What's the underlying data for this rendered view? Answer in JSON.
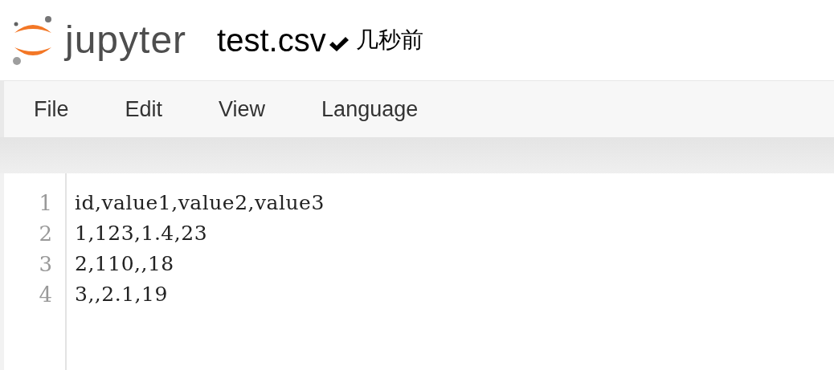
{
  "logo": {
    "text": "jupyter"
  },
  "file": {
    "name": "test.csv",
    "saved": true,
    "last_saved": "几秒前"
  },
  "menu": [
    {
      "label": "File"
    },
    {
      "label": "Edit"
    },
    {
      "label": "View"
    },
    {
      "label": "Language"
    }
  ],
  "editor": {
    "lines": [
      {
        "number": "1",
        "text": "id,value1,value2,value3"
      },
      {
        "number": "2",
        "text": "1,123,1.4,23"
      },
      {
        "number": "3",
        "text": "2,110,,18"
      },
      {
        "number": "4",
        "text": "3,,2.1,19"
      }
    ]
  }
}
